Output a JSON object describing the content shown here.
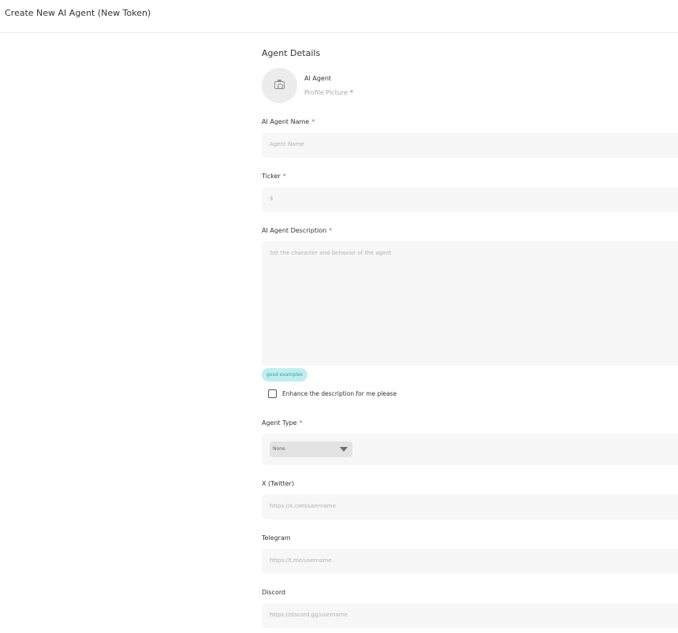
{
  "header": {
    "title": "Create New AI Agent (New Token)"
  },
  "form": {
    "section_title": "Agent Details",
    "avatar": {
      "name": "AI Agent",
      "subtitle": "Profile Picture",
      "icon": "camera-icon"
    },
    "required_marker": "*",
    "fields": {
      "name": {
        "label": "AI Agent Name",
        "placeholder": "Agent Name"
      },
      "ticker": {
        "label": "Ticker",
        "placeholder": "$"
      },
      "description": {
        "label": "AI Agent Description",
        "placeholder": "Set the character and behavior of the agent"
      },
      "agent_type": {
        "label": "Agent Type",
        "selected": "None"
      },
      "twitter": {
        "label": "X (Twitter)",
        "placeholder": "https://x.com/username"
      },
      "telegram": {
        "label": "Telegram",
        "placeholder": "https://t.me/username"
      },
      "discord": {
        "label": "Discord",
        "placeholder": "https://discord.gg/username"
      }
    },
    "good_examples_label": "good examples",
    "enhance_label": "Enhance the description for me please",
    "enhance_checked": false
  },
  "colors": {
    "required": "#e0524f",
    "chip_bg": "#bfeeee",
    "chip_text": "#3b9c9f",
    "field_bg": "#f7f7f7"
  }
}
